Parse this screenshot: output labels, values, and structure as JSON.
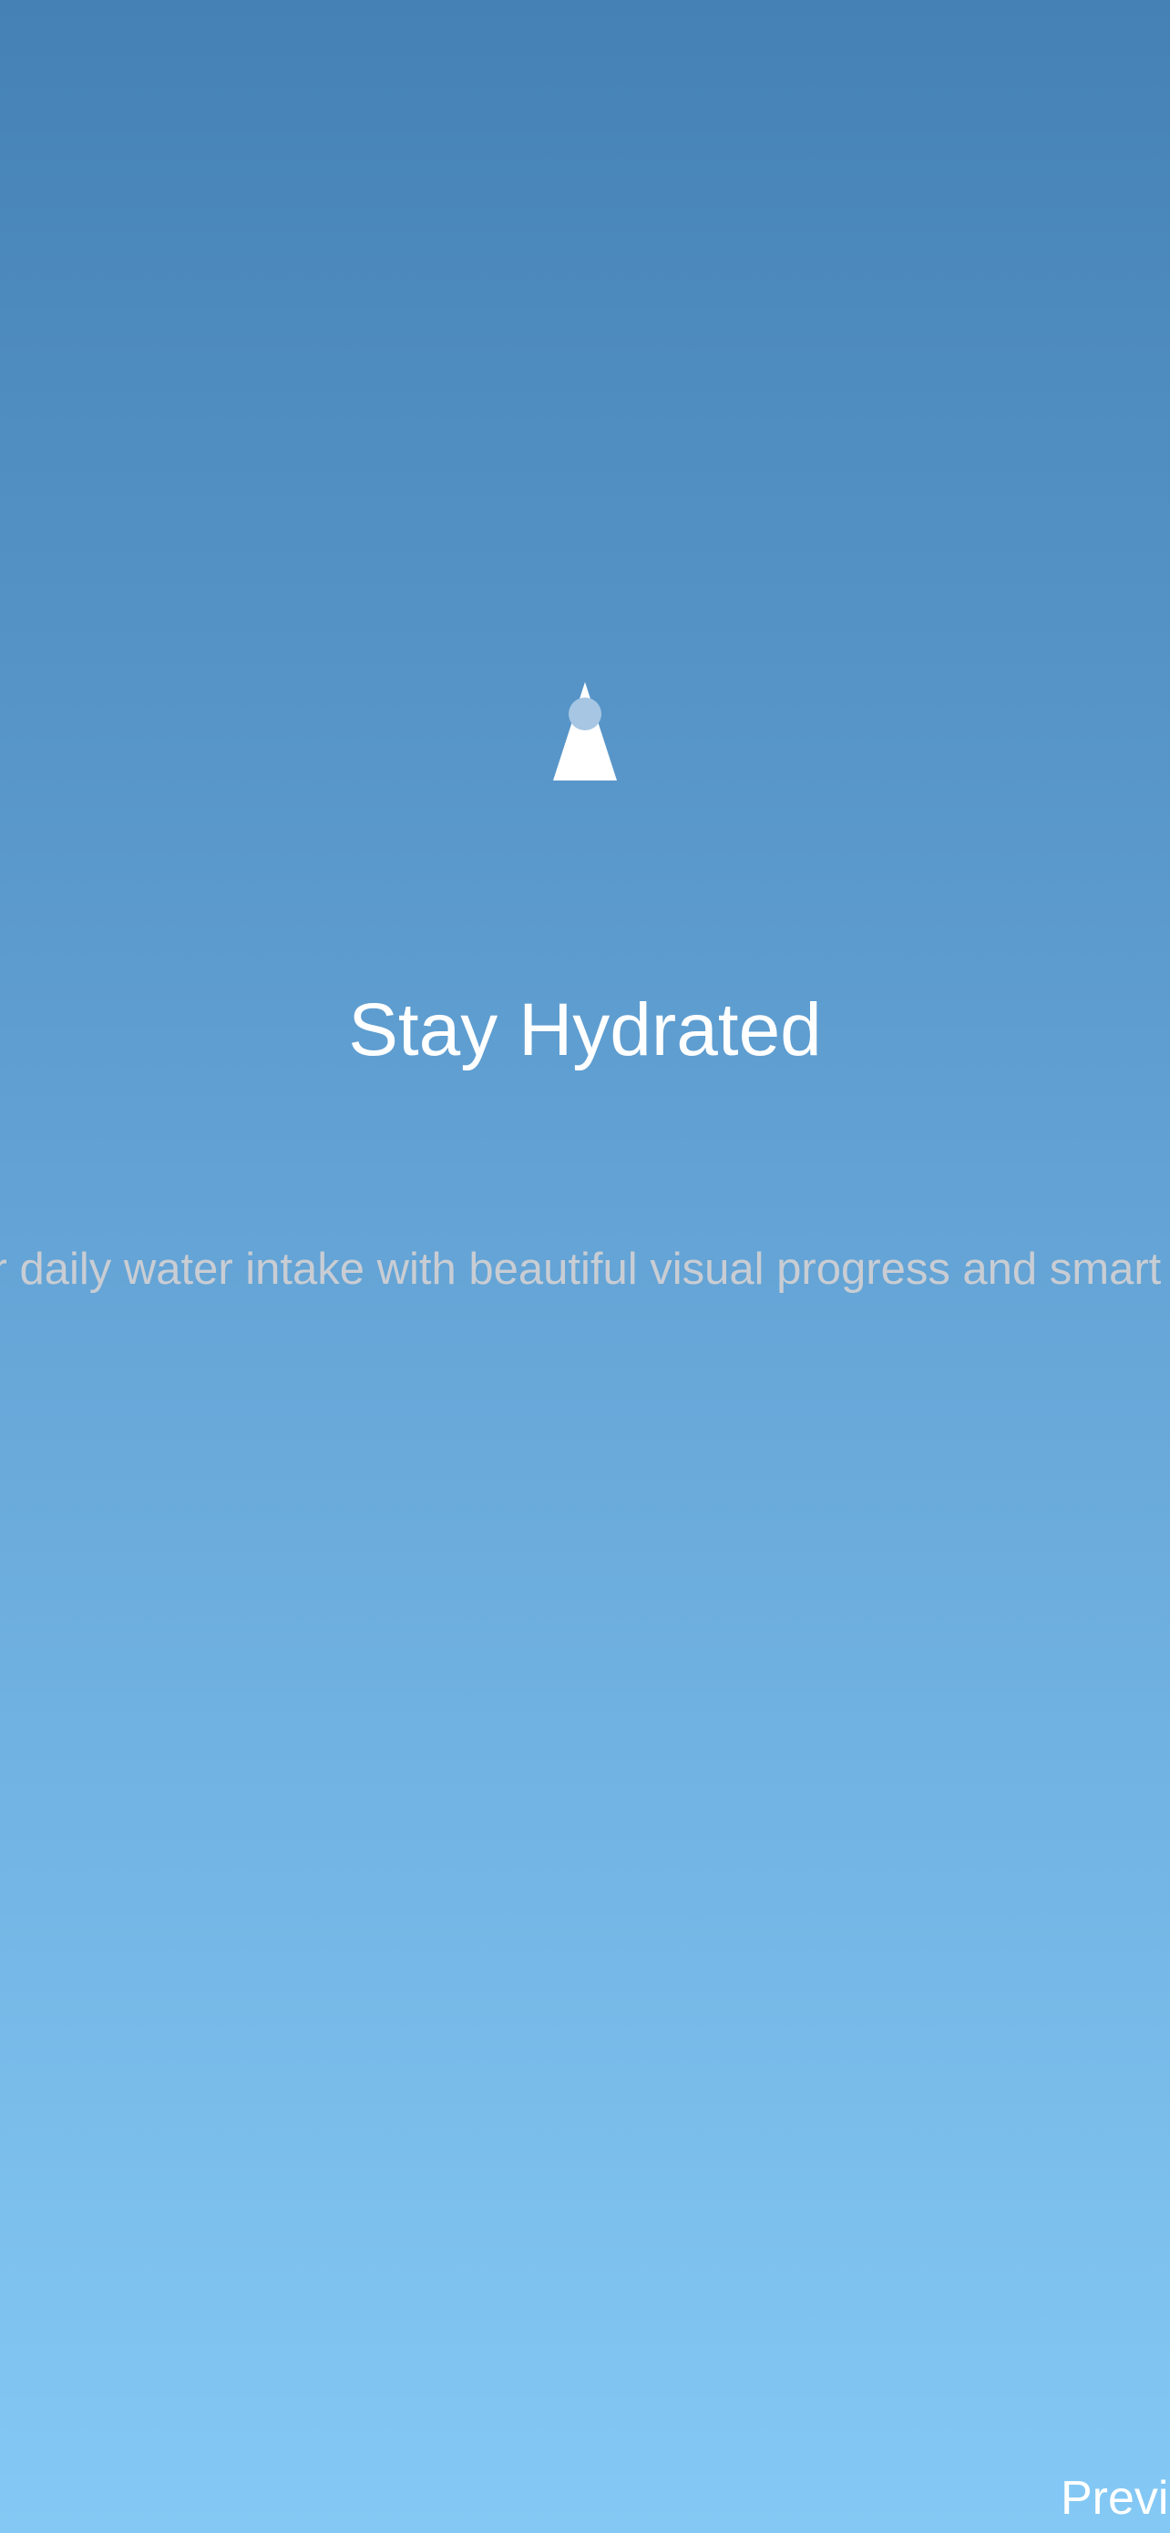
{
  "onboarding": {
    "icon": "water-drop-icon",
    "title": "Stay Hydrated",
    "subtitle": "Track your daily water intake with beautiful visual progress and smart reminders",
    "previous_label": "Previous"
  },
  "colors": {
    "gradient_top": "#4581b5",
    "gradient_bottom": "#84c9f5",
    "title": "#ffffff",
    "subtitle": "#c9cdd3",
    "icon": "#ffffff"
  }
}
